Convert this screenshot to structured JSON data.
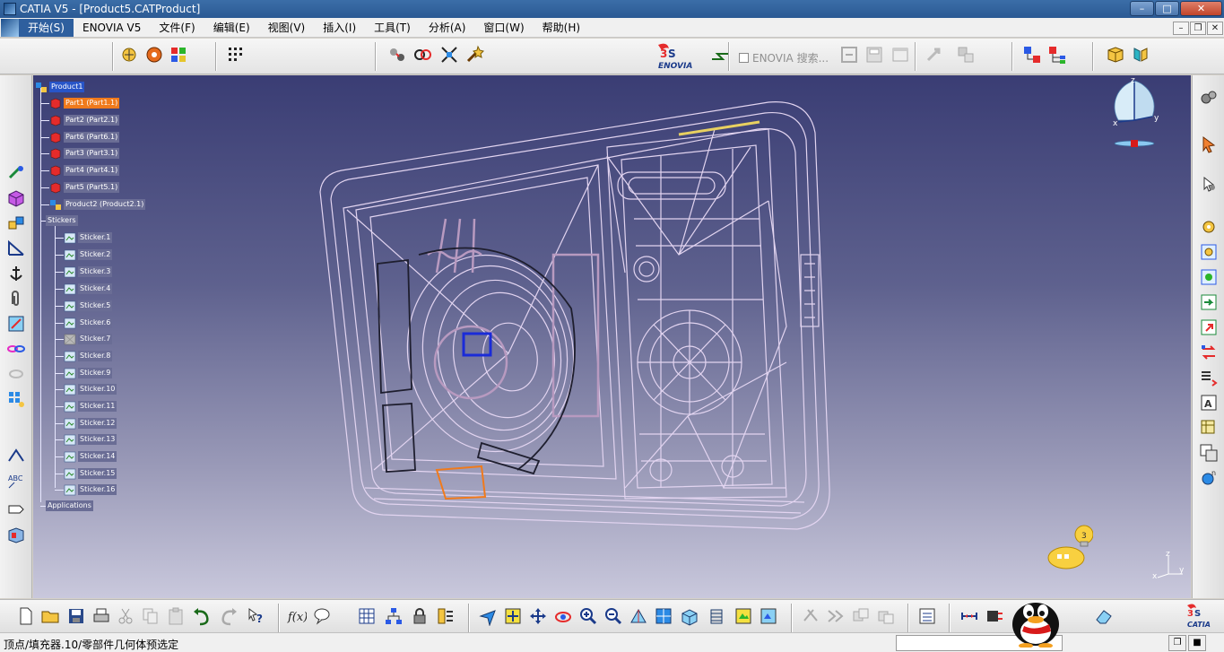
{
  "window": {
    "title": "CATIA V5 - [Product5.CATProduct]",
    "min_label": "–",
    "max_label": "□",
    "close_label": "✕"
  },
  "menu": {
    "items": [
      "开始(S)",
      "ENOVIA V5",
      "文件(F)",
      "编辑(E)",
      "视图(V)",
      "插入(I)",
      "工具(T)",
      "分析(A)",
      "窗口(W)",
      "帮助(H)"
    ]
  },
  "enovia": {
    "search_label": "ENOVIA 搜索..."
  },
  "tree": {
    "root": "Product1",
    "children": [
      {
        "label": "Part1 (Part1.1)",
        "state": "selected"
      },
      {
        "label": "Part2 (Part2.1)",
        "state": ""
      },
      {
        "label": "Part6 (Part6.1)",
        "state": ""
      },
      {
        "label": "Part3 (Part3.1)",
        "state": ""
      },
      {
        "label": "Part4 (Part4.1)",
        "state": ""
      },
      {
        "label": "Part5 (Part5.1)",
        "state": ""
      },
      {
        "label": "Product2 (Product2.1)",
        "state": ""
      }
    ],
    "stickers_label": "Stickers",
    "stickers": [
      "Sticker.1",
      "Sticker.2",
      "Sticker.3",
      "Sticker.4",
      "Sticker.5",
      "Sticker.6",
      "Sticker.7",
      "Sticker.8",
      "Sticker.9",
      "Sticker.10",
      "Sticker.11",
      "Sticker.12",
      "Sticker.13",
      "Sticker.14",
      "Sticker.15",
      "Sticker.16"
    ],
    "applications_label": "Applications"
  },
  "compass": {
    "x": "x",
    "y": "y",
    "z": "z"
  },
  "bulb_count": "3",
  "status": {
    "text": "顶点/填充器.10/零部件几何体预选定"
  },
  "colors": {
    "titlebar": "#2b5a94",
    "viewport_top": "#3a3d74",
    "viewport_bottom": "#c9c8dc",
    "wireframe": "#e2d4f0",
    "selection_orange": "#f07a1c"
  }
}
